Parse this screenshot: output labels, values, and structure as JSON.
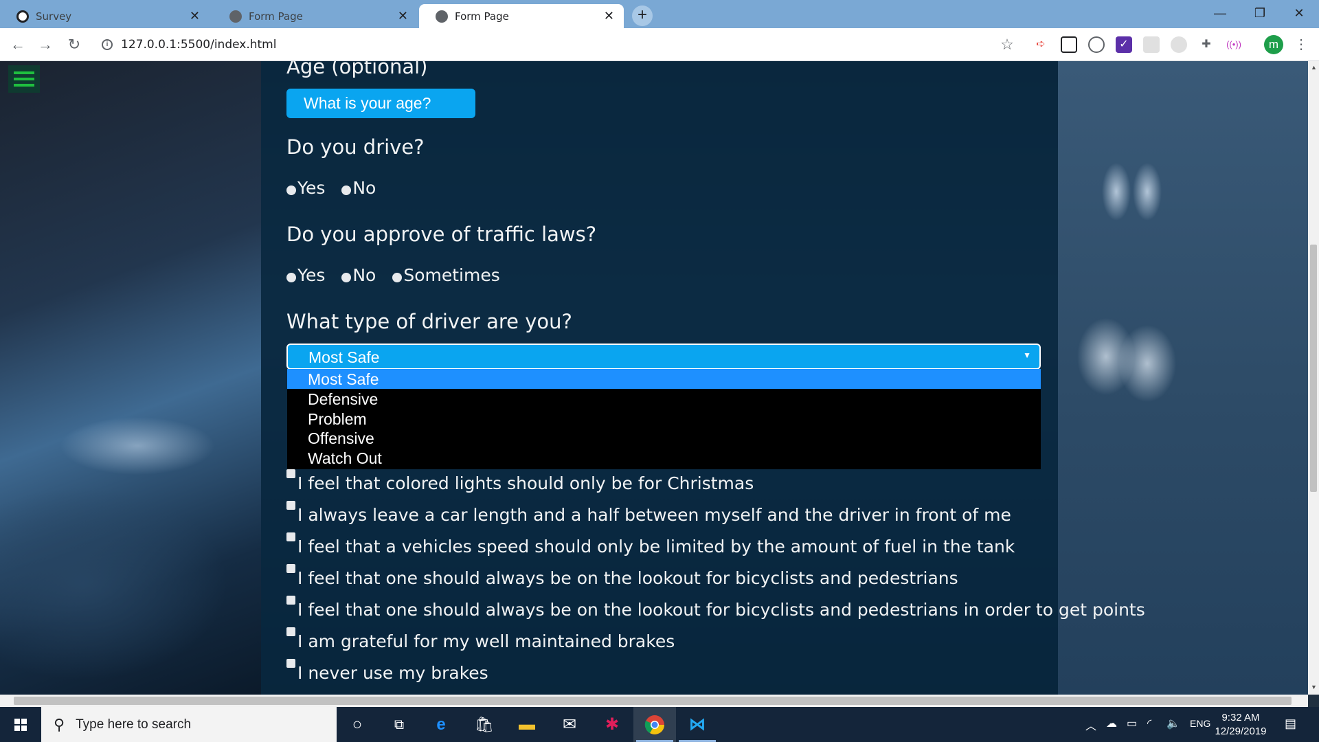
{
  "browser": {
    "tabs": [
      {
        "title": "Survey",
        "active": false
      },
      {
        "title": "Form Page",
        "active": false
      },
      {
        "title": "Form Page",
        "active": true
      }
    ],
    "url": "127.0.0.1:5500/index.html",
    "profile_initial": "m"
  },
  "form": {
    "age_label": "Age (optional)",
    "age_placeholder": "What is your age?",
    "drive_question": "Do you drive?",
    "drive_options": [
      "Yes",
      "No"
    ],
    "traffic_question": "Do you approve of traffic laws?",
    "traffic_options": [
      "Yes",
      "No",
      "Sometimes"
    ],
    "driver_type_question": "What type of driver are you?",
    "driver_type_selected": "Most Safe",
    "driver_type_options": [
      "Most Safe",
      "Defensive",
      "Problem",
      "Offensive",
      "Watch Out"
    ],
    "statements": [
      "I feel that colored lights should only be for Christmas",
      "I always leave a car length and a half between myself and the driver in front of me",
      "I feel that a vehicles speed should only be limited by the amount of fuel in the tank",
      "I feel that one should always be on the lookout for bicyclists and pedestrians",
      "I feel that one should always be on the lookout for bicyclists and pedestrians in order to get points",
      "I am grateful for my well maintained brakes",
      "I never use my brakes"
    ]
  },
  "taskbar": {
    "search_placeholder": "Type here to search",
    "language": "ENG",
    "time": "9:32 AM",
    "date": "12/29/2019"
  },
  "colors": {
    "accent": "#0aa5f0",
    "highlight": "#1e90ff",
    "panel": "#07263e",
    "menu_green": "#1fbf3f"
  }
}
